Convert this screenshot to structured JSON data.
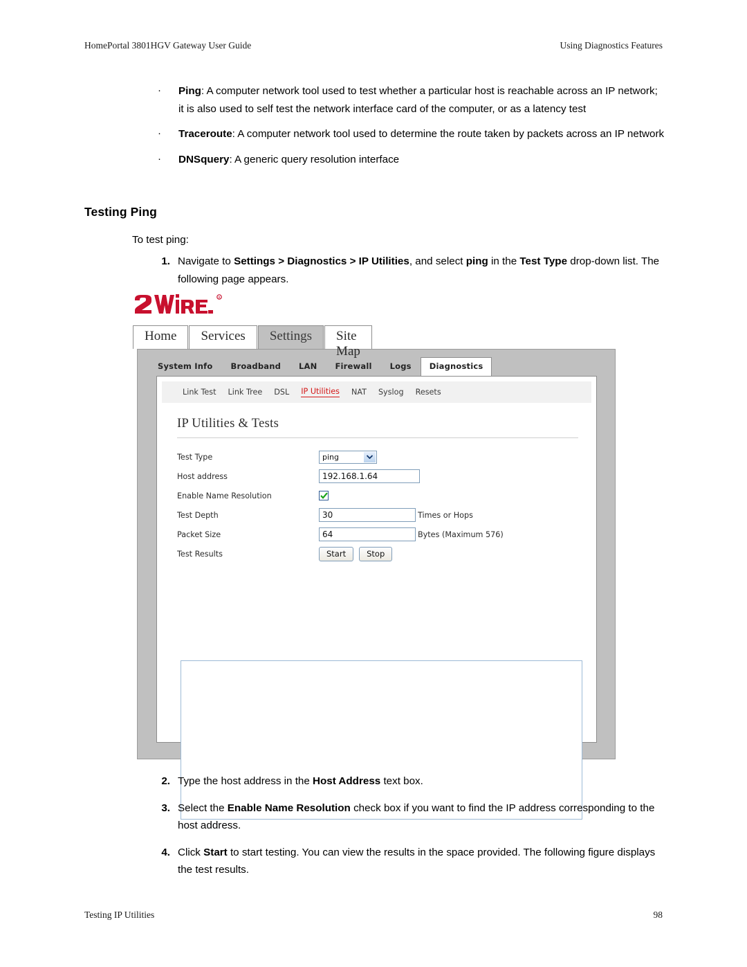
{
  "page": {
    "header_left": "HomePortal 3801HGV Gateway User Guide",
    "header_right": "Using Diagnostics Features",
    "footer_left": "Testing IP Utilities",
    "footer_right": "98"
  },
  "bullets": [
    {
      "term": "Ping",
      "text": ": A computer network tool used to test whether a particular host is reachable across an IP network; it is also used to self test the network interface card of the computer, or as a latency test"
    },
    {
      "term": "Traceroute",
      "text": ": A computer network tool used to determine the route taken by packets across an IP network"
    },
    {
      "term": "DNSquery",
      "text": ": A generic query resolution interface"
    }
  ],
  "section": {
    "title": "Testing Ping",
    "lead_in": "To test ping:"
  },
  "steps_top": [
    {
      "num": "1.",
      "parts": [
        {
          "t": "Navigate to ",
          "b": false
        },
        {
          "t": "Settings > Diagnostics > IP Utilities",
          "b": true
        },
        {
          "t": ", and select ",
          "b": false
        },
        {
          "t": "ping",
          "b": true
        },
        {
          "t": " in the ",
          "b": false
        },
        {
          "t": "Test Type",
          "b": true
        },
        {
          "t": " drop-down list. The following page appears.",
          "b": false
        }
      ]
    }
  ],
  "steps_bottom": [
    {
      "num": "2.",
      "parts": [
        {
          "t": "Type the host address in the ",
          "b": false
        },
        {
          "t": "Host Address",
          "b": true
        },
        {
          "t": " text box.",
          "b": false
        }
      ]
    },
    {
      "num": "3.",
      "parts": [
        {
          "t": "Select the ",
          "b": false
        },
        {
          "t": "Enable Name Resolution",
          "b": true
        },
        {
          "t": " check box if you want to find the IP address corresponding to the host address.",
          "b": false
        }
      ]
    },
    {
      "num": "4.",
      "parts": [
        {
          "t": "Click ",
          "b": false
        },
        {
          "t": "Start",
          "b": true
        },
        {
          "t": " to start testing. You can view the results in the space provided. The following figure displays the test results.",
          "b": false
        }
      ]
    }
  ],
  "figure": {
    "logo_text": "2WiRE",
    "logo_color": "#c8102e",
    "tabs": [
      {
        "label": "Home",
        "active": false
      },
      {
        "label": "Services",
        "active": false
      },
      {
        "label": "Settings",
        "active": true
      },
      {
        "label": "Site Map",
        "active": false
      }
    ],
    "subtabs": [
      {
        "label": "System Info",
        "active": false
      },
      {
        "label": "Broadband",
        "active": false
      },
      {
        "label": "LAN",
        "active": false
      },
      {
        "label": "Firewall",
        "active": false
      },
      {
        "label": "Logs",
        "active": false
      },
      {
        "label": "Diagnostics",
        "active": true
      }
    ],
    "utilnav": [
      {
        "label": "Link Test",
        "active": false
      },
      {
        "label": "Link Tree",
        "active": false
      },
      {
        "label": "DSL",
        "active": false
      },
      {
        "label": "IP Utilities",
        "active": true
      },
      {
        "label": "NAT",
        "active": false
      },
      {
        "label": "Syslog",
        "active": false
      },
      {
        "label": "Resets",
        "active": false
      }
    ],
    "panel_heading": "IP Utilities & Tests",
    "form": {
      "test_type_label": "Test Type",
      "test_type_value": "ping",
      "host_label": "Host address",
      "host_value": "192.168.1.64",
      "name_resolution_label": "Enable Name Resolution",
      "test_depth_label": "Test Depth",
      "test_depth_value": "30",
      "test_depth_suffix": "Times or Hops",
      "packet_size_label": "Packet Size",
      "packet_size_value": "64",
      "packet_size_suffix": "Bytes (Maximum 576)",
      "test_results_label": "Test Results",
      "start_label": "Start",
      "stop_label": "Stop",
      "results_value": ""
    },
    "accent_red": "#d41818",
    "chrome_gray": "#c0c0c0"
  }
}
